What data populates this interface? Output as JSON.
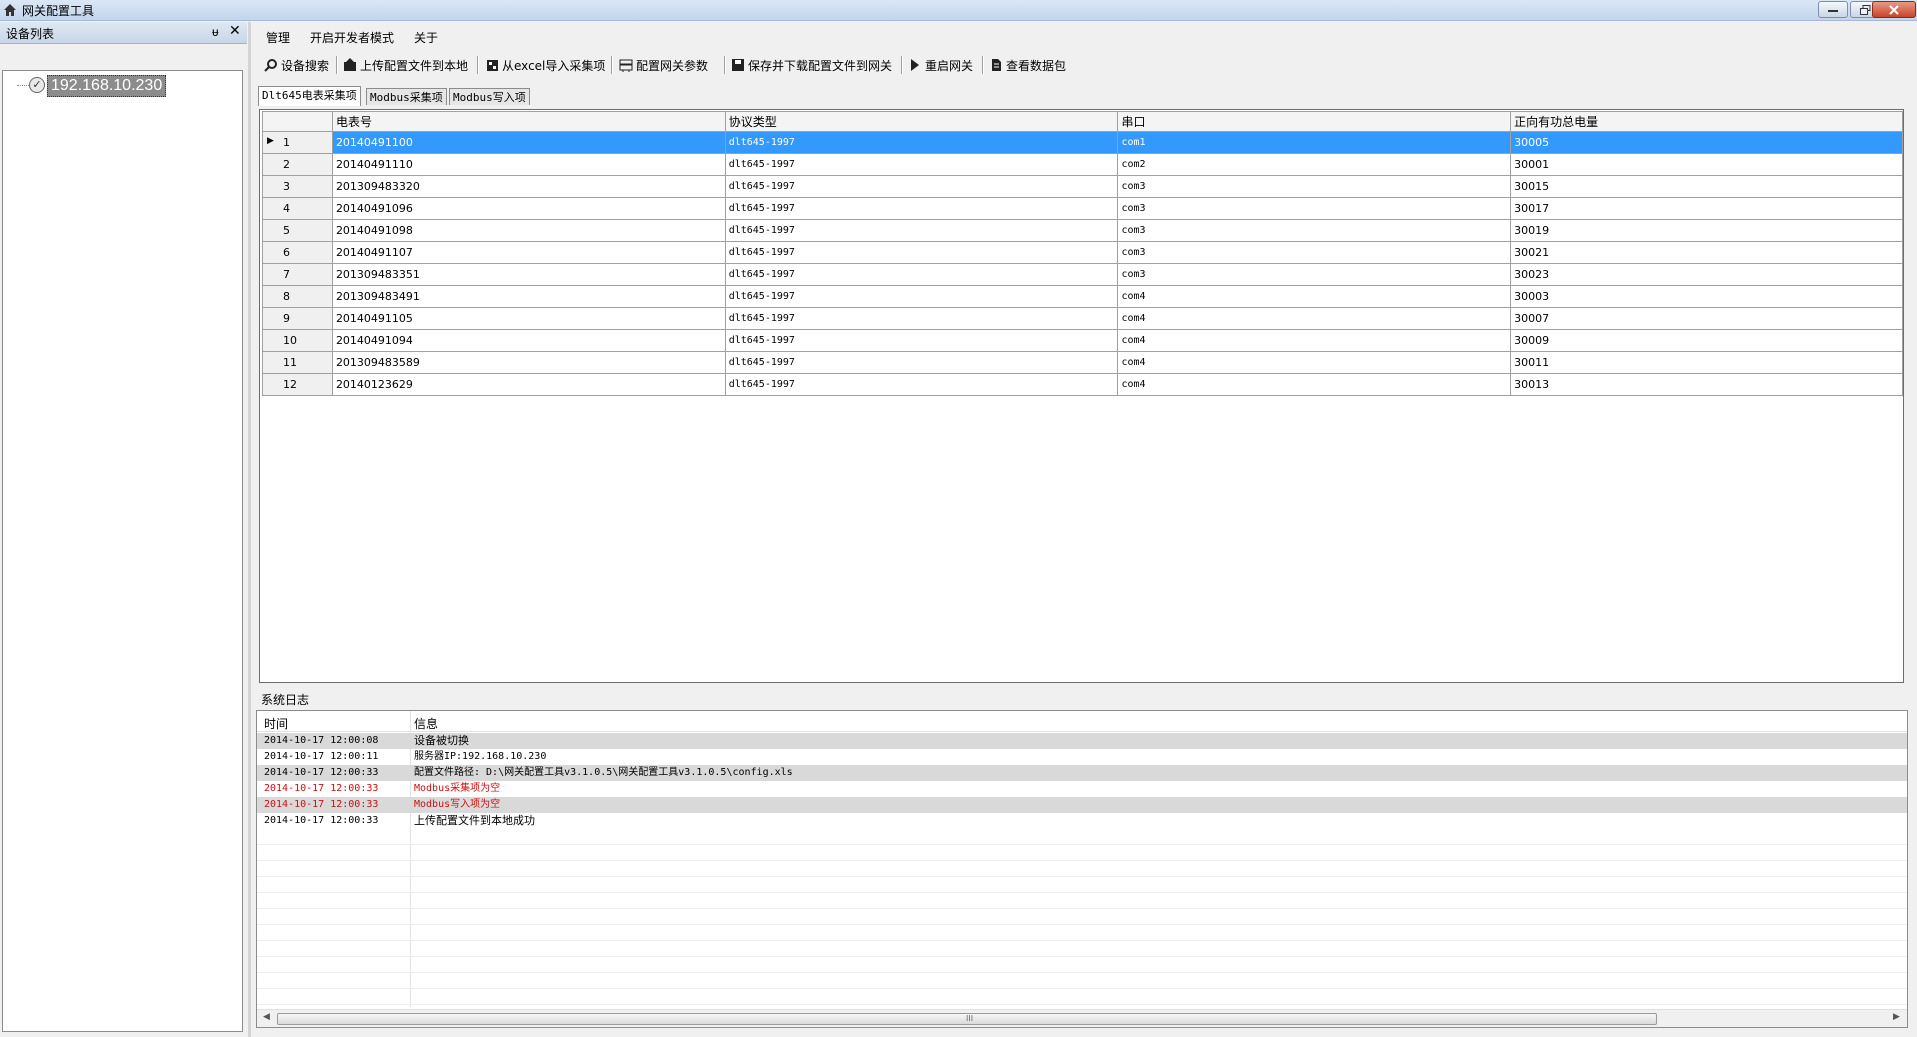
{
  "window": {
    "title": "网关配置工具",
    "buttons": [
      "minimize",
      "restore",
      "close"
    ]
  },
  "device_panel": {
    "title": "设备列表",
    "pin_glyph": "ᵾ",
    "close_glyph": "✕",
    "tree": [
      {
        "label": "192.168.10.230",
        "selected": true
      }
    ]
  },
  "menu": [
    "管理",
    "开启开发者模式",
    "关于"
  ],
  "toolbar": [
    {
      "label": "设备搜索",
      "icon": "search-icon"
    },
    {
      "label": "上传配置文件到本地",
      "icon": "upload-icon"
    },
    {
      "label": "从excel导入采集项",
      "icon": "import-icon"
    },
    {
      "label": "配置网关参数",
      "icon": "config-icon"
    },
    {
      "label": "保存并下载配置文件到网关",
      "icon": "save-icon"
    },
    {
      "label": "重启网关",
      "icon": "play-icon"
    },
    {
      "label": "查看数据包",
      "icon": "document-icon"
    }
  ],
  "tabs": [
    {
      "label": "Dlt645电表采集项",
      "active": true
    },
    {
      "label": "Modbus采集项",
      "active": false
    },
    {
      "label": "Modbus写入项",
      "active": false
    }
  ],
  "grid": {
    "columns": [
      "电表号",
      "协议类型",
      "串口",
      "正向有功总电量"
    ],
    "rows": [
      {
        "n": "1",
        "meter": "20140491100",
        "protocol": "dlt645-1997",
        "port": "com1",
        "energy": "30005"
      },
      {
        "n": "2",
        "meter": "20140491110",
        "protocol": "dlt645-1997",
        "port": "com2",
        "energy": "30001"
      },
      {
        "n": "3",
        "meter": "201309483320",
        "protocol": "dlt645-1997",
        "port": "com3",
        "energy": "30015"
      },
      {
        "n": "4",
        "meter": "20140491096",
        "protocol": "dlt645-1997",
        "port": "com3",
        "energy": "30017"
      },
      {
        "n": "5",
        "meter": "20140491098",
        "protocol": "dlt645-1997",
        "port": "com3",
        "energy": "30019"
      },
      {
        "n": "6",
        "meter": "20140491107",
        "protocol": "dlt645-1997",
        "port": "com3",
        "energy": "30021"
      },
      {
        "n": "7",
        "meter": "201309483351",
        "protocol": "dlt645-1997",
        "port": "com3",
        "energy": "30023"
      },
      {
        "n": "8",
        "meter": "201309483491",
        "protocol": "dlt645-1997",
        "port": "com4",
        "energy": "30003"
      },
      {
        "n": "9",
        "meter": "20140491105",
        "protocol": "dlt645-1997",
        "port": "com4",
        "energy": "30007"
      },
      {
        "n": "10",
        "meter": "20140491094",
        "protocol": "dlt645-1997",
        "port": "com4",
        "energy": "30009"
      },
      {
        "n": "11",
        "meter": "201309483589",
        "protocol": "dlt645-1997",
        "port": "com4",
        "energy": "30011"
      },
      {
        "n": "12",
        "meter": "20140123629",
        "protocol": "dlt645-1997",
        "port": "com4",
        "energy": "30013"
      }
    ],
    "selected_row": 0
  },
  "log": {
    "title": "系统日志",
    "columns": [
      "时间",
      "信息"
    ],
    "entries": [
      {
        "time": "2014-10-17 12:00:08",
        "msg": "设备被切换",
        "error": false
      },
      {
        "time": "2014-10-17 12:00:11",
        "msg": "服务器IP:192.168.10.230",
        "error": false
      },
      {
        "time": "2014-10-17 12:00:33",
        "msg": "配置文件路径: D:\\网关配置工具v3.1.0.5\\网关配置工具v3.1.0.5\\config.xls",
        "error": false
      },
      {
        "time": "2014-10-17 12:00:33",
        "msg": "Modbus采集项为空",
        "error": true
      },
      {
        "time": "2014-10-17 12:00:33",
        "msg": "Modbus写入项为空",
        "error": true
      },
      {
        "time": "2014-10-17 12:00:33",
        "msg": "上传配置文件到本地成功",
        "error": false
      }
    ],
    "scrollbar": {
      "left_arrow": "◀",
      "right_arrow": "▶",
      "grip": "III"
    }
  },
  "colors": {
    "selection": "#3399ff",
    "error_text": "#cc1111",
    "close_button": "#c8442a"
  }
}
